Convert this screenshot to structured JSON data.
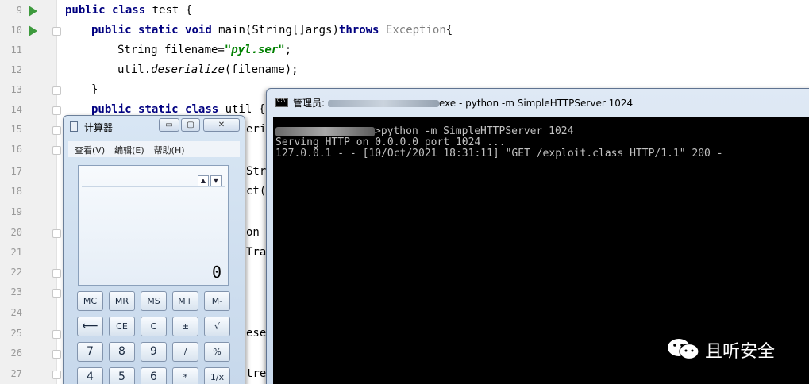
{
  "editor": {
    "line_numbers": [
      "9",
      "10",
      "11",
      "12",
      "13",
      "14",
      "15",
      "16",
      "17",
      "18",
      "19",
      "20",
      "21",
      "22",
      "23",
      "24",
      "25",
      "26",
      "27"
    ],
    "line9": {
      "kw1": "public",
      "kw2": "class",
      "rest": " test {"
    },
    "line10": {
      "kw1": "public",
      "kw2": "static",
      "kw3": "void",
      "name": " main(String[]args)",
      "kw4": "throws",
      "exc": " Exception",
      "brace": "{"
    },
    "line11": {
      "prefix": "String filename=",
      "str": "\"pyl.ser\"",
      "suffix": ";"
    },
    "line12": {
      "prefix": "util.",
      "method": "deserialize",
      "suffix": "(filename);"
    },
    "line13": {
      "text": "}"
    },
    "line14": {
      "kw1": "public",
      "kw2": "static",
      "kw3": "class",
      "rest": " util {"
    },
    "line15_fragment": "eri",
    "line17_fragment": "Str",
    "line18_fragment": "ct(",
    "line20_fragment": "on",
    "line21_fragment": "Tra",
    "line25_fragment": "ese",
    "line27_fragment": "tre"
  },
  "calculator": {
    "title": "计算器",
    "window_buttons": {
      "minimize": "▭",
      "maximize": "▢",
      "close": "✕"
    },
    "menu": [
      "查看(V)",
      "编辑(E)",
      "帮助(H)"
    ],
    "display_value": "0",
    "display_arrows": [
      "▲",
      "▼"
    ],
    "keys": [
      [
        "MC",
        "MR",
        "MS",
        "M+",
        "M-"
      ],
      [
        "⟵",
        "CE",
        "C",
        "±",
        "√"
      ],
      [
        "7",
        "8",
        "9",
        "/",
        "%"
      ],
      [
        "4",
        "5",
        "6",
        "*",
        "1/x"
      ]
    ]
  },
  "cmd": {
    "title_prefix": "管理员: ",
    "title_suffix": "exe - python  -m SimpleHTTPServer 1024",
    "lines": [
      ">python -m SimpleHTTPServer 1024",
      "Serving HTTP on 0.0.0.0 port 1024 ...",
      "127.0.0.1 - - [10/Oct/2021 18:31:11] \"GET /exploit.class HTTP/1.1\" 200 -"
    ]
  },
  "watermark": {
    "text": "且听安全"
  }
}
